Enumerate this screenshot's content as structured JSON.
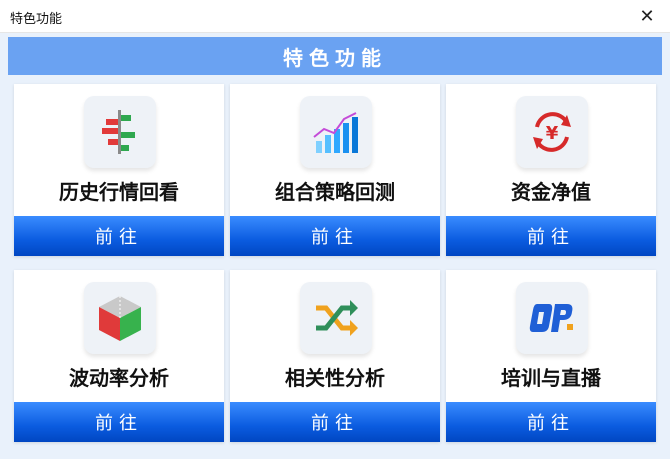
{
  "window": {
    "title": "特色功能"
  },
  "banner": {
    "text": "特色功能"
  },
  "colors": {
    "banner": "#6aa2f2",
    "button": "#0b5ce0",
    "background": "#e9f1fb"
  },
  "cards": [
    {
      "label": "历史行情回看",
      "button": "前往",
      "icon": "history-chart-icon"
    },
    {
      "label": "组合策略回测",
      "button": "前往",
      "icon": "growth-chart-icon"
    },
    {
      "label": "资金净值",
      "button": "前往",
      "icon": "yen-cycle-icon"
    },
    {
      "label": "波动率分析",
      "button": "前往",
      "icon": "cube-icon"
    },
    {
      "label": "相关性分析",
      "button": "前往",
      "icon": "shuffle-icon"
    },
    {
      "label": "培训与直播",
      "button": "前往",
      "icon": "op-logo-icon"
    }
  ]
}
